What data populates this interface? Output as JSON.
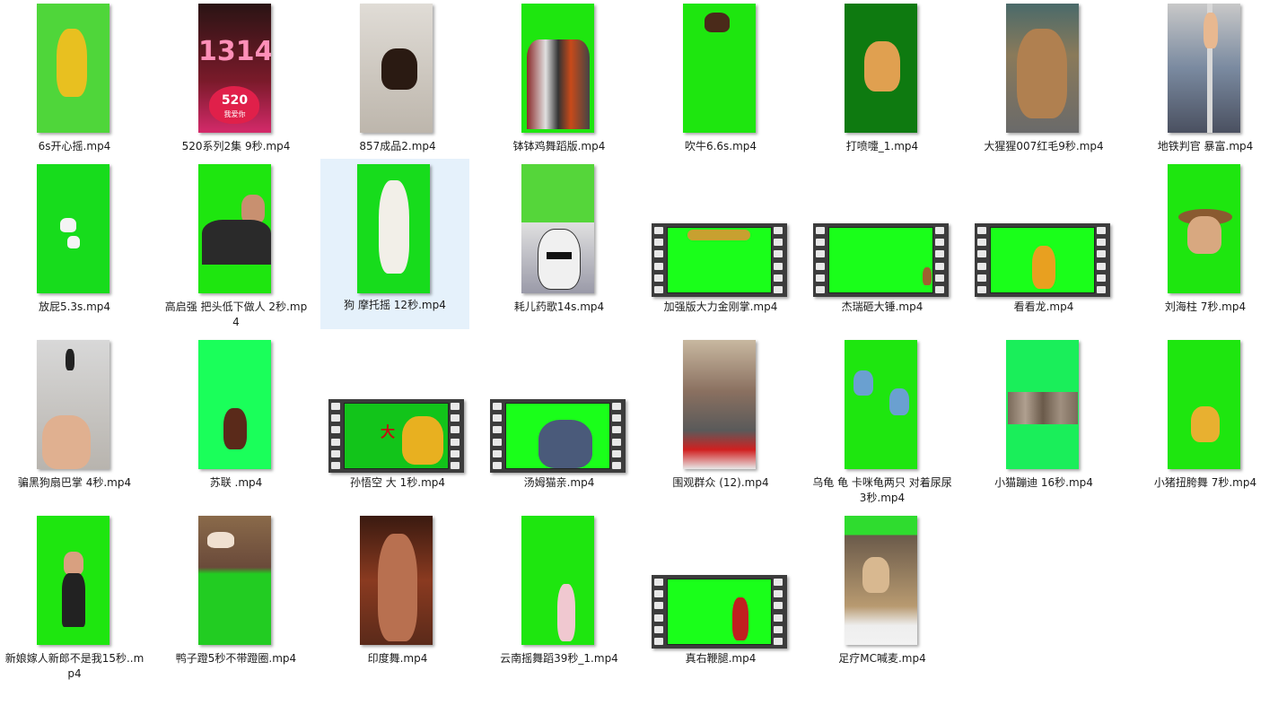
{
  "files": [
    {
      "name": "6s开心摇.mp4"
    },
    {
      "name": "520系列2集 9秒.mp4"
    },
    {
      "name": "857成品2.mp4"
    },
    {
      "name": "钵钵鸡舞蹈版.mp4"
    },
    {
      "name": "吹牛6.6s.mp4"
    },
    {
      "name": "打喷嚏_1.mp4"
    },
    {
      "name": "大猩猩007红毛9秒.mp4"
    },
    {
      "name": "地铁判官  暴富.mp4"
    },
    {
      "name": "放屁5.3s.mp4"
    },
    {
      "name": "高启强 把头低下做人 2秒.mp4"
    },
    {
      "name": "狗 摩托摇 12秒.mp4",
      "selected": true
    },
    {
      "name": "耗儿药歌14s.mp4"
    },
    {
      "name": "加强版大力金刚掌.mp4"
    },
    {
      "name": "杰瑞砸大锤.mp4"
    },
    {
      "name": "看看龙.mp4"
    },
    {
      "name": "刘海柱 7秒.mp4"
    },
    {
      "name": "骗黑狗扇巴掌 4秒.mp4"
    },
    {
      "name": "苏联 .mp4"
    },
    {
      "name": "孙悟空 大 1秒.mp4"
    },
    {
      "name": "汤姆猫亲.mp4"
    },
    {
      "name": "围观群众 (12).mp4"
    },
    {
      "name": "乌龟 龟  卡咪龟两只 对着尿尿 3秒.mp4"
    },
    {
      "name": "小猫蹦迪 16秒.mp4"
    },
    {
      "name": "小猪扭胯舞 7秒.mp4"
    },
    {
      "name": "新娘嫁人新郎不是我15秒..mp4"
    },
    {
      "name": "鸭子蹬5秒不带蹬圈.mp4"
    },
    {
      "name": "印度舞.mp4"
    },
    {
      "name": "云南摇舞蹈39秒_1.mp4"
    },
    {
      "name": "真右鞭腿.mp4"
    },
    {
      "name": "足疗MC喊麦.mp4"
    }
  ],
  "thumb_text": {
    "t1": "1314",
    "t2": "520",
    "t3": "我爱你",
    "t18": "大"
  }
}
